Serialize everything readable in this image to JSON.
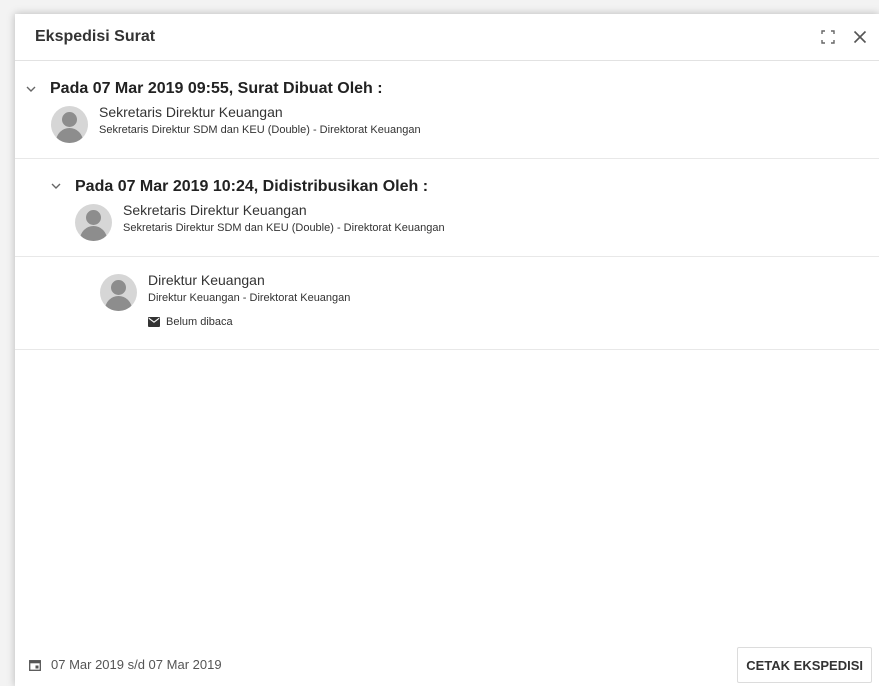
{
  "dialog": {
    "title": "Ekspedisi Surat",
    "icons": {
      "expand": "expand-icon",
      "close": "close-icon"
    }
  },
  "events": [
    {
      "title": "Pada 07 Mar 2019 09:55, Surat Dibuat Oleh :",
      "person": {
        "name": "Sekretaris Direktur Keuangan",
        "role": "Sekretaris Direktur SDM dan KEU (Double) - Direktorat Keuangan"
      }
    },
    {
      "title": "Pada 07 Mar 2019 10:24, Didistribusikan Oleh :",
      "person": {
        "name": "Sekretaris Direktur Keuangan",
        "role": "Sekretaris Direktur SDM dan KEU (Double) - Direktorat Keuangan"
      },
      "recipients": [
        {
          "name": "Direktur Keuangan",
          "role": "Direktur Keuangan - Direktorat Keuangan",
          "status": "Belum dibaca"
        }
      ]
    }
  ],
  "footer": {
    "date_range": "07 Mar 2019 s/d 07 Mar 2019",
    "print_label": "CETAK EKSPEDISI"
  }
}
